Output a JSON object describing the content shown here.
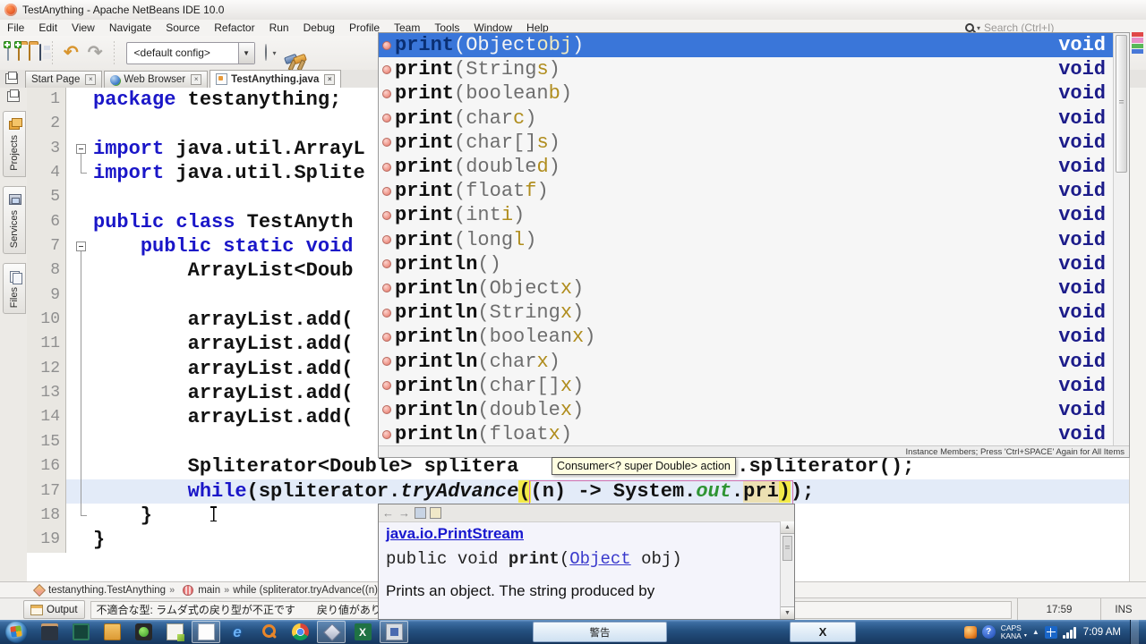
{
  "icons": {
    "close": "×",
    "dropdown": "▼",
    "small_caret": "▾",
    "up_arrow": "▲",
    "back": "←",
    "forward": "→",
    "chevron": "»",
    "undo": "↶",
    "redo": "↷",
    "help": "?",
    "ie_letter": "e",
    "excel_letter": "X",
    "scroll_up": "▲",
    "scroll_down": "▼"
  },
  "titlebar": {
    "title": "TestAnything - Apache NetBeans IDE 10.0"
  },
  "menubar": {
    "items": [
      "File",
      "Edit",
      "View",
      "Navigate",
      "Source",
      "Refactor",
      "Run",
      "Debug",
      "Profile",
      "Team",
      "Tools",
      "Window",
      "Help"
    ],
    "search_placeholder": "Search (Ctrl+I)"
  },
  "toolbar": {
    "config_value": "<default config>"
  },
  "tabs": [
    {
      "label": "Start Page",
      "state": "",
      "icon": "none"
    },
    {
      "label": "Web Browser",
      "state": "",
      "icon": "web"
    },
    {
      "label": "TestAnything.java",
      "state": "active",
      "icon": "java"
    }
  ],
  "rail": [
    {
      "label": "Projects",
      "icon": "ri-projects",
      "name": "sidebar-tab-projects"
    },
    {
      "label": "Services",
      "icon": "ri-services",
      "name": "sidebar-tab-services"
    },
    {
      "label": "Files",
      "icon": "ri-files",
      "name": "sidebar-tab-files"
    }
  ],
  "editor": {
    "lines": [
      {
        "num": "1",
        "fold": "",
        "state": "",
        "segments": [
          {
            "t": "package",
            "c": "kw"
          },
          {
            "t": " testanything;",
            "c": "pl"
          }
        ]
      },
      {
        "num": "2",
        "fold": "",
        "state": "",
        "segments": []
      },
      {
        "num": "3",
        "fold": "fbox",
        "state": "",
        "segments": [
          {
            "t": "import",
            "c": "kw"
          },
          {
            "t": " java.util.ArrayL",
            "c": "pl"
          }
        ]
      },
      {
        "num": "4",
        "fold": "fend",
        "state": "",
        "segments": [
          {
            "t": "import",
            "c": "kw"
          },
          {
            "t": " java.util.Splite",
            "c": "pl"
          }
        ]
      },
      {
        "num": "5",
        "fold": "",
        "state": "",
        "segments": []
      },
      {
        "num": "6",
        "fold": "",
        "state": "",
        "segments": [
          {
            "t": "public class",
            "c": "kw"
          },
          {
            "t": " TestAnyth",
            "c": "pl"
          }
        ]
      },
      {
        "num": "7",
        "fold": "fbox",
        "state": "",
        "segments": [
          {
            "t": "    ",
            "c": "pl"
          },
          {
            "t": "public static void",
            "c": "kw"
          }
        ]
      },
      {
        "num": "8",
        "fold": "fline",
        "state": "",
        "segments": [
          {
            "t": "        ArrayList<Doub",
            "c": "pl"
          }
        ]
      },
      {
        "num": "9",
        "fold": "fline",
        "state": "",
        "segments": []
      },
      {
        "num": "10",
        "fold": "fline",
        "state": "",
        "segments": [
          {
            "t": "        arrayList.add(",
            "c": "pl"
          }
        ]
      },
      {
        "num": "11",
        "fold": "fline",
        "state": "",
        "segments": [
          {
            "t": "        arrayList.add(",
            "c": "pl"
          }
        ]
      },
      {
        "num": "12",
        "fold": "fline",
        "state": "",
        "segments": [
          {
            "t": "        arrayList.add(",
            "c": "pl"
          }
        ]
      },
      {
        "num": "13",
        "fold": "fline",
        "state": "",
        "segments": [
          {
            "t": "        arrayList.add(",
            "c": "pl"
          }
        ]
      },
      {
        "num": "14",
        "fold": "fline",
        "state": "",
        "segments": [
          {
            "t": "        arrayList.add(",
            "c": "pl"
          }
        ]
      },
      {
        "num": "15",
        "fold": "fline",
        "state": "",
        "segments": []
      },
      {
        "num": "16",
        "fold": "fline",
        "state": "",
        "segments": [
          {
            "t": "        Spliterator<Double> splitera",
            "c": "pl"
          },
          {
            "t": "",
            "c": "gap"
          },
          {
            "t": ".spliterator();",
            "c": "pl"
          }
        ]
      },
      {
        "num": "17",
        "fold": "fline",
        "state": "current",
        "segments": [
          {
            "t": "        ",
            "c": "pl"
          },
          {
            "t": "while",
            "c": "kw"
          },
          {
            "t": "(spliterator.",
            "c": "pl"
          },
          {
            "t": "tryAdvance",
            "c": "itl"
          },
          {
            "t": "(",
            "c": "ylw"
          },
          {
            "t": "(n) -> System.",
            "c": "pl"
          },
          {
            "t": "out",
            "c": "fld"
          },
          {
            "t": ".",
            "c": "pl"
          },
          {
            "t": "pri",
            "c": "pfx"
          },
          {
            "t": ")",
            "c": "ylw"
          },
          {
            "t": ");",
            "c": "pl"
          }
        ]
      },
      {
        "num": "18",
        "fold": "fend",
        "state": "",
        "segments": [
          {
            "t": "    }",
            "c": "pl"
          }
        ]
      },
      {
        "num": "19",
        "fold": "",
        "state": "",
        "segments": [
          {
            "t": "}",
            "c": "pl"
          }
        ]
      }
    ],
    "param_tooltip": "Consumer<? super Double> action",
    "caret_position": "17:59",
    "insert_mode": "INS"
  },
  "completion": {
    "items": [
      {
        "state": "selected",
        "name": "print",
        "left": "(Object ",
        "pname": "obj",
        "right": ")",
        "ret": "void"
      },
      {
        "state": "",
        "name": "print",
        "left": "(String ",
        "pname": "s",
        "right": ")",
        "ret": "void"
      },
      {
        "state": "",
        "name": "print",
        "left": "(boolean ",
        "pname": "b",
        "right": ")",
        "ret": "void"
      },
      {
        "state": "",
        "name": "print",
        "left": "(char ",
        "pname": "c",
        "right": ")",
        "ret": "void"
      },
      {
        "state": "",
        "name": "print",
        "left": "(char[] ",
        "pname": "s",
        "right": ")",
        "ret": "void"
      },
      {
        "state": "",
        "name": "print",
        "left": "(double ",
        "pname": "d",
        "right": ")",
        "ret": "void"
      },
      {
        "state": "",
        "name": "print",
        "left": "(float ",
        "pname": "f",
        "right": ")",
        "ret": "void"
      },
      {
        "state": "",
        "name": "print",
        "left": "(int ",
        "pname": "i",
        "right": ")",
        "ret": "void"
      },
      {
        "state": "",
        "name": "print",
        "left": "(long ",
        "pname": "l",
        "right": ")",
        "ret": "void"
      },
      {
        "state": "",
        "name": "println",
        "left": "()",
        "pname": "",
        "right": "",
        "ret": "void"
      },
      {
        "state": "",
        "name": "println",
        "left": "(Object ",
        "pname": "x",
        "right": ")",
        "ret": "void"
      },
      {
        "state": "",
        "name": "println",
        "left": "(String ",
        "pname": "x",
        "right": ")",
        "ret": "void"
      },
      {
        "state": "",
        "name": "println",
        "left": "(boolean ",
        "pname": "x",
        "right": ")",
        "ret": "void"
      },
      {
        "state": "",
        "name": "println",
        "left": "(char ",
        "pname": "x",
        "right": ")",
        "ret": "void"
      },
      {
        "state": "",
        "name": "println",
        "left": "(char[] ",
        "pname": "x",
        "right": ")",
        "ret": "void"
      },
      {
        "state": "",
        "name": "println",
        "left": "(double ",
        "pname": "x",
        "right": ")",
        "ret": "void"
      },
      {
        "state": "",
        "name": "println",
        "left": "(float ",
        "pname": "x",
        "right": ")",
        "ret": "void"
      }
    ],
    "footer": "Instance Members; Press 'Ctrl+SPACE' Again for All Items"
  },
  "javadoc": {
    "class_link": "java.io.PrintStream",
    "sig_pre": "public void ",
    "sig_name": "print",
    "sig_open": "(",
    "sig_type": "Object",
    "sig_rest": " obj)",
    "description": "Prints an object. The string produced by"
  },
  "breadcrumb": [
    {
      "label": "testanything.TestAnything",
      "icon": "bc-class",
      "sep": "»"
    },
    {
      "label": "main",
      "icon": "bc-method",
      "sep": "»"
    },
    {
      "label": "while (spliterator.tryAdvance((n)",
      "icon": "none",
      "sep": ""
    }
  ],
  "status": {
    "output_label": "Output",
    "message": "不適合な型: ラムダ式の戻り型が不正です　　戻り値がありません シンボルを",
    "caret": "17:59",
    "mode": "INS"
  },
  "taskbar": {
    "apps": [
      {
        "name": "media-app-icon",
        "cls": "ico-media",
        "frame": "",
        "glyph": ""
      },
      {
        "name": "dark-app-icon",
        "cls": "ico-dark",
        "frame": "",
        "glyph": ""
      },
      {
        "name": "explorer-folder-icon",
        "cls": "ico-fold2",
        "frame": "",
        "glyph": ""
      },
      {
        "name": "player-app-icon",
        "cls": "ico-gom",
        "frame": "",
        "glyph": ""
      },
      {
        "name": "notepad-icon",
        "cls": "ico-note",
        "frame": "",
        "glyph": ""
      },
      {
        "name": "document-app-icon",
        "cls": "ico-doc",
        "frame": "framed",
        "glyph": ""
      },
      {
        "name": "internet-explorer-icon",
        "cls": "ico-ie",
        "frame": "",
        "glyph": "e"
      },
      {
        "name": "search-app-icon",
        "cls": "ico-mag",
        "frame": "",
        "glyph": ""
      },
      {
        "name": "chrome-icon",
        "cls": "ico-chrome",
        "frame": "",
        "glyph": ""
      },
      {
        "name": "netbeans-taskbar-icon",
        "cls": "ico-nb",
        "frame": "framed",
        "glyph": ""
      },
      {
        "name": "excel-icon",
        "cls": "ico-xl",
        "frame": "",
        "glyph": "X"
      },
      {
        "name": "generic-app-icon",
        "cls": "ico-app",
        "frame": "framed",
        "glyph": ""
      }
    ],
    "warning_button_label": "警告",
    "x_button_label": "X",
    "tray": {
      "caps": "CAPS",
      "kana": "KANA",
      "time": "7:09 AM"
    }
  }
}
